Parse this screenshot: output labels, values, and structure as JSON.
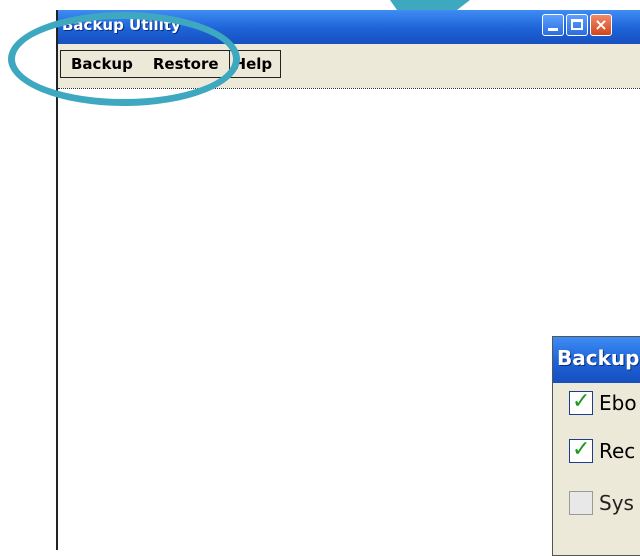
{
  "window": {
    "title": "Backup Utility",
    "controls": {
      "minimize": "minimize",
      "maximize": "maximize",
      "close": "×"
    }
  },
  "menubar": {
    "items": [
      {
        "label": "Backup"
      },
      {
        "label": "Restore"
      },
      {
        "label": "Help"
      }
    ]
  },
  "dialog": {
    "title": "Backup",
    "options": [
      {
        "label": "Ebo",
        "checked": true
      },
      {
        "label": "Rec",
        "checked": true
      },
      {
        "label": "Sys",
        "checked": false
      }
    ]
  },
  "colors": {
    "titlebar": "#1d63d8",
    "menubar_bg": "#ece9d8",
    "callout": "#3ea8c0",
    "check": "#1a9a1a"
  }
}
